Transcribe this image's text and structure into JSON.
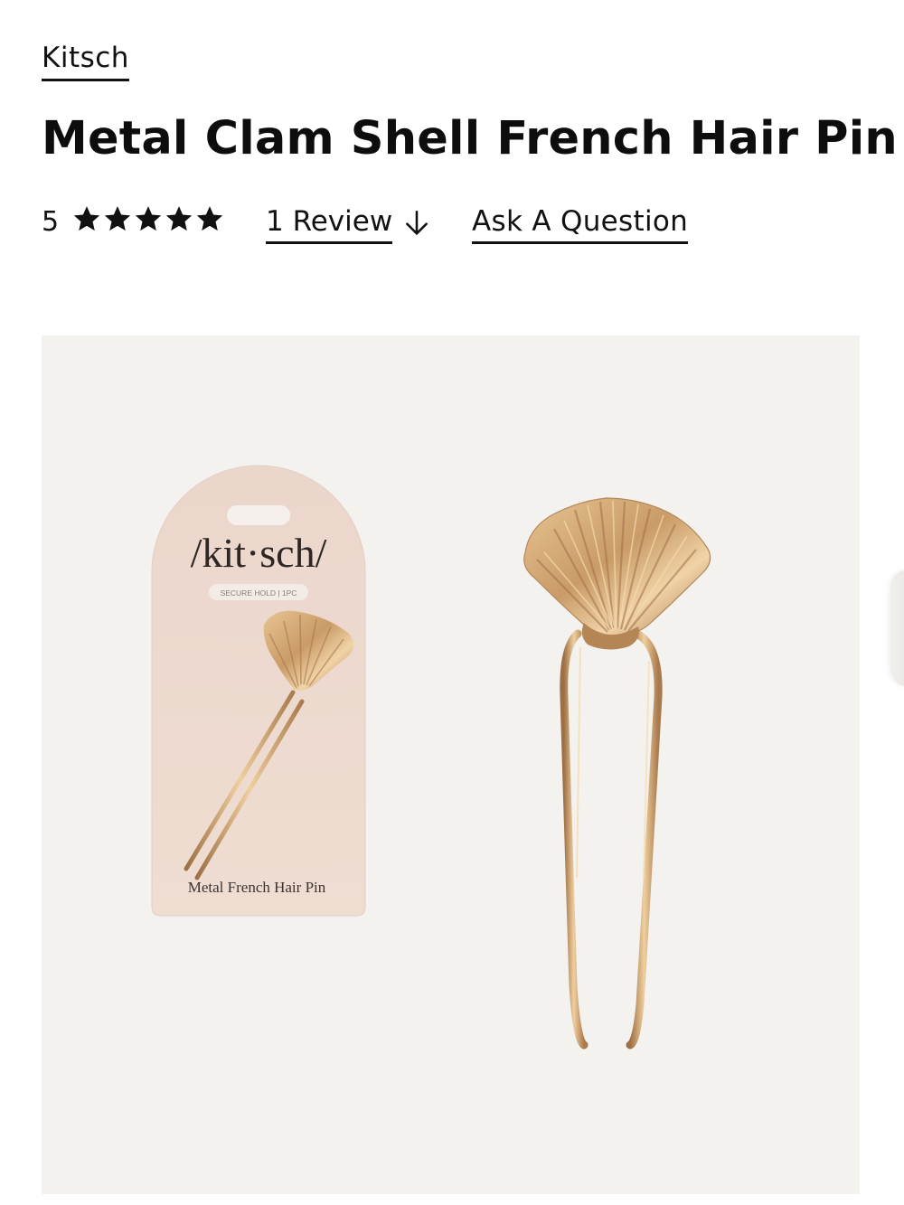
{
  "brand": {
    "label": "Kitsch"
  },
  "product": {
    "title": "Metal Clam Shell French Hair Pin"
  },
  "rating": {
    "value": "5",
    "stars_filled": 5,
    "stars_total": 5,
    "review_link_label": "1 Review",
    "ask_link_label": "Ask A Question"
  },
  "gallery": {
    "package": {
      "logo_text": "/kit·sch/",
      "badge_text": "SECURE HOLD | 1PC",
      "product_name": "Metal French Hair Pin"
    }
  },
  "colors": {
    "text": "#111111",
    "gallery_background": "#f4f2ef",
    "package_card": "#efdcd3",
    "gold": "#c9a070"
  },
  "icons": {
    "star": "star-icon",
    "arrow": "arrow-down-icon"
  }
}
